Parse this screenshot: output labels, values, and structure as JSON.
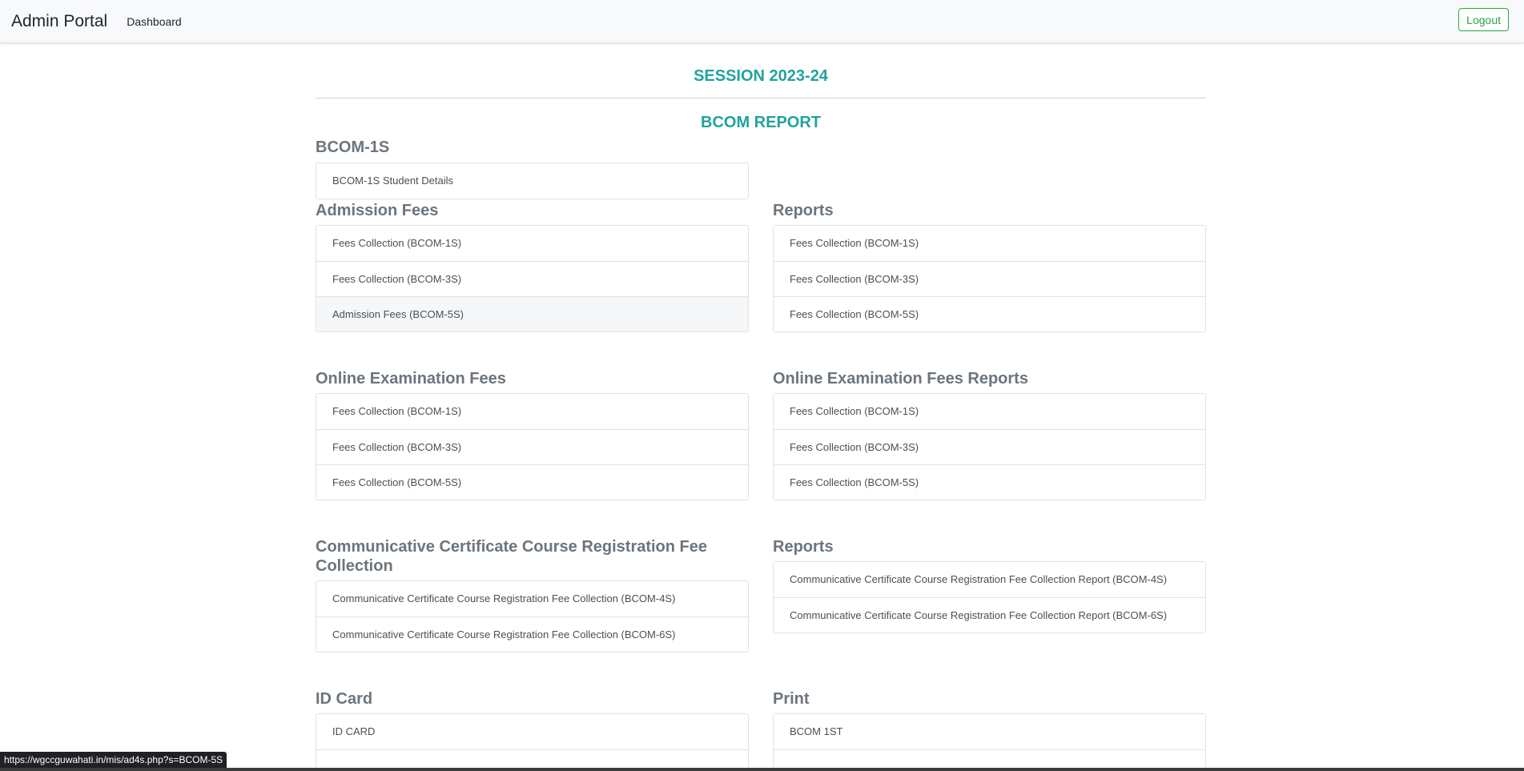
{
  "navbar": {
    "brand": "Admin Portal",
    "links": [
      "Dashboard"
    ],
    "logout_label": "Logout"
  },
  "header": {
    "session": "SESSION 2023-24",
    "report": "BCOM REPORT"
  },
  "student_section": {
    "heading": "BCOM-1S",
    "items": [
      "BCOM-1S Student Details"
    ]
  },
  "admission_fees": {
    "heading": "Admission Fees",
    "items": [
      "Fees Collection (BCOM-1S)",
      "Fees Collection (BCOM-3S)",
      "Admission Fees (BCOM-5S)"
    ],
    "hovered_item": "Admission Fees (BCOM-5S)"
  },
  "admission_reports": {
    "heading": "Reports",
    "items": [
      "Fees Collection (BCOM-1S)",
      "Fees Collection (BCOM-3S)",
      "Fees Collection (BCOM-5S)"
    ]
  },
  "online_exam_fees": {
    "heading": "Online Examination Fees",
    "items": [
      "Fees Collection (BCOM-1S)",
      "Fees Collection (BCOM-3S)",
      "Fees Collection (BCOM-5S)"
    ]
  },
  "online_exam_reports": {
    "heading": "Online Examination Fees Reports",
    "items": [
      "Fees Collection (BCOM-1S)",
      "Fees Collection (BCOM-3S)",
      "Fees Collection (BCOM-5S)"
    ]
  },
  "ccc_fees": {
    "heading": "Communicative Certificate Course Registration Fee Collection",
    "items": [
      "Communicative Certificate Course Registration Fee Collection (BCOM-4S)",
      "Communicative Certificate Course Registration Fee Collection (BCOM-6S)"
    ]
  },
  "ccc_reports": {
    "heading": "Reports",
    "items": [
      "Communicative Certificate Course Registration Fee Collection Report (BCOM-4S)",
      "Communicative Certificate Course Registration Fee Collection Report (BCOM-6S)"
    ]
  },
  "id_card": {
    "heading": "ID Card",
    "items": [
      "ID CARD"
    ]
  },
  "print": {
    "heading": "Print",
    "items": [
      "BCOM 1ST"
    ]
  },
  "status_bar": {
    "url": "https://wgccguwahati.in/mis/ad4s.php?s=BCOM-5S"
  },
  "colors": {
    "accent_teal": "#20a39e",
    "logout_green": "#28a745",
    "heading_gray": "#6c757d"
  }
}
